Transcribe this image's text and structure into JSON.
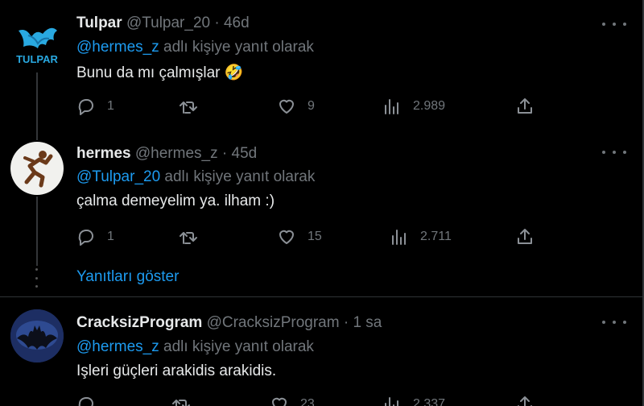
{
  "tweets": [
    {
      "name": "Tulpar",
      "handle": "@Tulpar_20",
      "dot": "·",
      "time": "46d",
      "reply_mention": "@hermes_z",
      "reply_suffix": "adlı kişiye yanıt olarak",
      "text": "Bunu da mı çalmışlar 🤣",
      "avatar_text": "TULPAR",
      "replies": "1",
      "likes": "9",
      "views": "2.989"
    },
    {
      "name": "hermes",
      "handle": "@hermes_z",
      "dot": "·",
      "time": "45d",
      "reply_mention": "@Tulpar_20",
      "reply_suffix": "adlı kişiye yanıt olarak",
      "text": "çalma demeyelim ya. ilham :)",
      "replies": "1",
      "likes": "15",
      "views": "2.711"
    },
    {
      "name": "CracksizProgram",
      "handle": "@CracksizProgram",
      "dot": "·",
      "time": "1 sa",
      "reply_mention": "@hermes_z",
      "reply_suffix": "adlı kişiye yanıt olarak",
      "text": "Işleri güçleri arakidis arakidis.",
      "replies": "",
      "likes": "23",
      "views": "2.337"
    }
  ],
  "show_replies_label": "Yanıtları göster",
  "icons": [
    "reply-icon",
    "retweet-icon",
    "like-icon",
    "views-icon",
    "share-icon",
    "more-icon"
  ],
  "colors": {
    "background": "#000000",
    "link": "#1d9bf0",
    "muted": "#71767b",
    "text": "#e7e9ea"
  }
}
